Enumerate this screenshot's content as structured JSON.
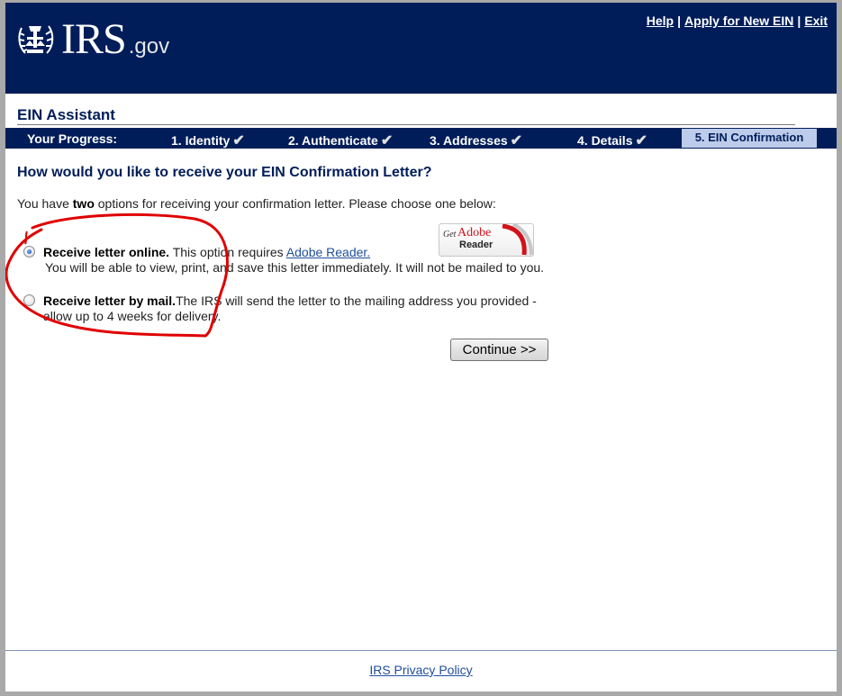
{
  "header": {
    "logo_main": "IRS",
    "logo_suffix": ".gov",
    "links": [
      {
        "label": "Help"
      },
      {
        "label": "Apply for New EIN"
      },
      {
        "label": "Exit"
      }
    ],
    "separator": "|",
    "bg_color": "#001d59"
  },
  "app": {
    "title": "EIN Assistant"
  },
  "progress": {
    "label": "Your Progress:",
    "steps": [
      {
        "label": "1. Identity",
        "complete": true
      },
      {
        "label": "2. Authenticate",
        "complete": true
      },
      {
        "label": "3. Addresses",
        "complete": true
      },
      {
        "label": "4. Details",
        "complete": true
      },
      {
        "label": "5. EIN Confirmation",
        "current": true
      }
    ],
    "check_glyph": "✔"
  },
  "main": {
    "question": "How would you like to receive your EIN Confirmation Letter?",
    "intro_before": "You have ",
    "intro_bold": "two",
    "intro_after": " options for receiving your confirmation letter. Please choose one below:",
    "options": [
      {
        "title": "Receive letter online.",
        "desc_before_link": " This option requires ",
        "link": "Adobe Reader.",
        "line2": "You will be able to view, print, and save this letter immediately. It will not be mailed to you.",
        "selected": true
      },
      {
        "title": "Receive letter by mail.",
        "desc": "The IRS will send the letter to the mailing address you provided -",
        "line2": "allow up to 4 weeks for delivery.",
        "selected": false
      }
    ],
    "adobe_badge": {
      "get": "Get",
      "adobe": "Adobe",
      "reader": "Reader"
    },
    "continue_label": "Continue >>"
  },
  "footer": {
    "privacy_link": "IRS Privacy Policy"
  },
  "annotation": {
    "color": "#e00000",
    "description": "red hand-drawn circle around online option"
  }
}
